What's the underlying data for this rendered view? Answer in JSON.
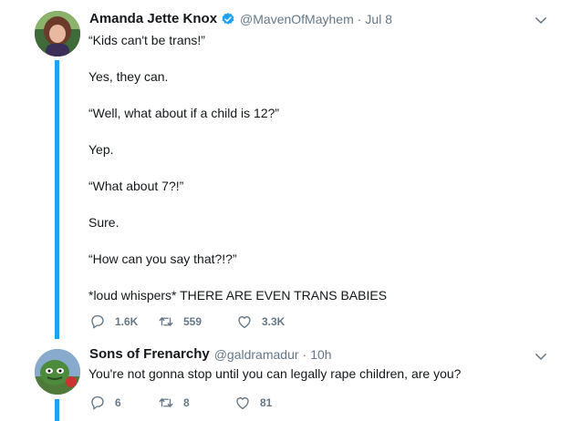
{
  "colors": {
    "accent": "#1da1f2",
    "text": "#14171a",
    "muted": "#657786"
  },
  "tweets": [
    {
      "name": "Amanda Jette Knox",
      "verified": true,
      "handle": "@MavenOfMayhem",
      "separator": "·",
      "time": "Jul 8",
      "lines": [
        "“Kids can't be trans!”",
        "Yes, they can.",
        "“Well, what about if a child is 12?”",
        "Yep.",
        "“What about 7?!”",
        "Sure.",
        "“How can you say that?!?”",
        "*loud whispers* THERE ARE EVEN TRANS BABIES"
      ],
      "replies": "1.6K",
      "retweets": "559",
      "likes": "3.3K"
    },
    {
      "name": "Sons of Frenarchy",
      "verified": false,
      "handle": "@galdramadur",
      "separator": "·",
      "time": "10h",
      "lines": [
        "You're not gonna stop until you can legally rape children, are you?"
      ],
      "replies": "6",
      "retweets": "8",
      "likes": "81"
    }
  ]
}
